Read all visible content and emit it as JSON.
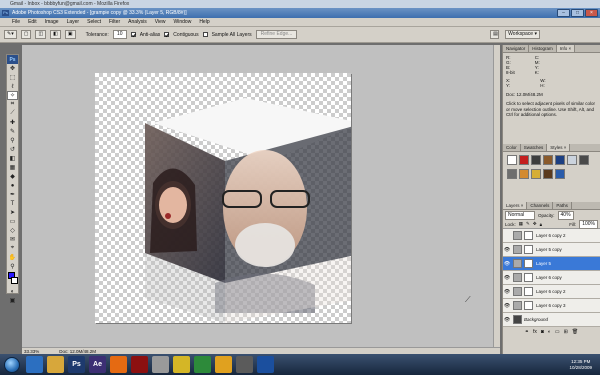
{
  "firefox_title": "Gmail - Inbox - bbbbyfun@gmail.com - Mozilla Firefox",
  "ps_title": "Adobe Photoshop CS3 Extended - [grampie copy @ 33.3% (Layer 5, RGB/8#)]",
  "menu": [
    "File",
    "Edit",
    "Image",
    "Layer",
    "Select",
    "Filter",
    "Analysis",
    "View",
    "Window",
    "Help"
  ],
  "options": {
    "tolerance_label": "Tolerance:",
    "tolerance_value": "10",
    "antialias": "Anti-alias",
    "contiguous": "Contiguous",
    "sample_all": "Sample All Layers",
    "refine_edge": "Refine Edge...",
    "workspace": "Workspace ▾"
  },
  "status": {
    "zoom": "33.33%",
    "doc": "Doc: 12.0M/48.2M"
  },
  "info_panel": {
    "tabs": [
      "Navigator",
      "Histogram",
      "Info ×"
    ],
    "rgb": [
      "R:",
      "G:",
      "B:"
    ],
    "cmyk": [
      "C:",
      "M:",
      "Y:",
      "K:"
    ],
    "pct": "8-bit",
    "x_label": "X:",
    "y_label": "Y:",
    "w_label": "W:",
    "h_label": "H:",
    "doc": "Doc: 12.0M/48.2M",
    "help": "Click to select adjacent pixels of similar color or move selection outline. Use Shift, Alt, and Ctrl for additional options."
  },
  "color_panel": {
    "tabs": [
      "Color",
      "Swatches",
      "Styles ×"
    ],
    "swatch_colors": [
      "#ffffff",
      "#c41e1e",
      "#3d3d3d",
      "#8a5a2b",
      "#1c3f82",
      "#cbd3dd",
      "#4a4a4a",
      "#6e6e6e",
      "#d38a2f",
      "#d6ae35",
      "#5a3a1e",
      "#2a5caa"
    ]
  },
  "layers_panel": {
    "tabs": [
      "Layers ×",
      "Channels",
      "Paths"
    ],
    "mode": "Normal",
    "opacity_label": "Opacity:",
    "opacity": "40%",
    "lock_label": "Lock:",
    "fill_label": "Fill:",
    "fill": "100%",
    "layers": [
      {
        "name": "Layer 6 copy 2",
        "visible": false,
        "selected": false,
        "dark": false
      },
      {
        "name": "Layer 5 copy",
        "visible": true,
        "selected": false,
        "dark": false
      },
      {
        "name": "Layer 5",
        "visible": true,
        "selected": true,
        "dark": false
      },
      {
        "name": "Layer 6 copy",
        "visible": true,
        "selected": false,
        "dark": false
      },
      {
        "name": "Layer 6 copy 2",
        "visible": true,
        "selected": false,
        "dark": false
      },
      {
        "name": "Layer 6 copy 3",
        "visible": true,
        "selected": false,
        "dark": false
      },
      {
        "name": "Background",
        "visible": true,
        "selected": false,
        "dark": true
      }
    ]
  },
  "taskbar": {
    "apps": [
      {
        "label": "",
        "color": "#2c6fc0"
      },
      {
        "label": "",
        "color": "#d7a73b"
      },
      {
        "label": "Ps",
        "color": "#1e3a6e"
      },
      {
        "label": "Ae",
        "color": "#3c2f74"
      },
      {
        "label": "",
        "color": "#e56a12"
      },
      {
        "label": "",
        "color": "#8c1010"
      },
      {
        "label": "",
        "color": "#9a9a9a"
      },
      {
        "label": "",
        "color": "#d4b626"
      },
      {
        "label": "",
        "color": "#2d8a3a"
      },
      {
        "label": "",
        "color": "#e0a11f"
      },
      {
        "label": "",
        "color": "#5b5b5b"
      },
      {
        "label": "",
        "color": "#1b4f9e"
      }
    ],
    "time": "12:35 PM",
    "date": "10/28/2009"
  }
}
